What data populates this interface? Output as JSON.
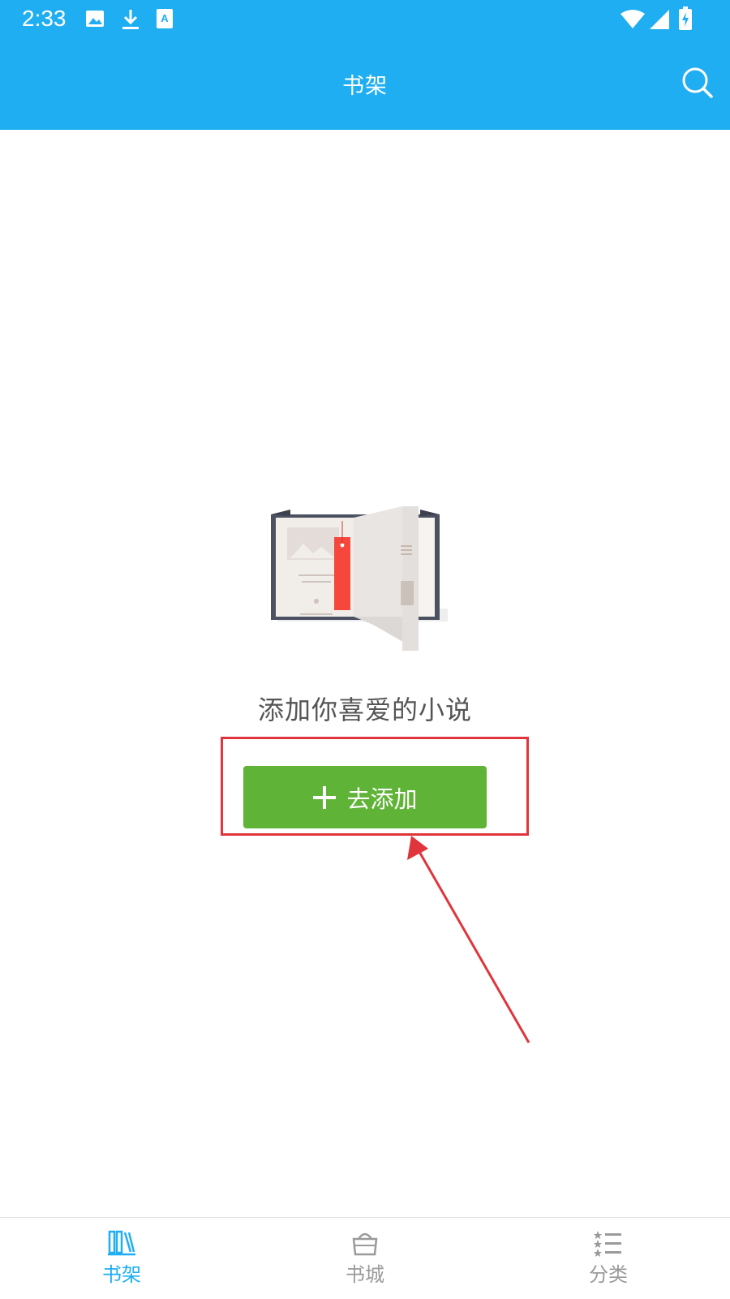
{
  "status_bar": {
    "time": "2:33",
    "left_icons": [
      "image-icon",
      "download-icon",
      "text-a-icon"
    ],
    "right_icons": [
      "wifi-icon",
      "signal-icon",
      "battery-charging-icon"
    ]
  },
  "app_bar": {
    "title": "书架",
    "action_icon": "search-icon",
    "color": "#1faef2"
  },
  "empty_state": {
    "illustration": "open-book-bookmark",
    "message": "添加你喜爱的小说",
    "button_label": "去添加",
    "button_icon": "plus-icon",
    "button_color": "#5fb336"
  },
  "annotation": {
    "box_color": "#e0353c",
    "arrow_color": "#e0353c"
  },
  "bottom_nav": {
    "active_color": "#1faef2",
    "inactive_color": "#9a9a9a",
    "items": [
      {
        "label": "书架",
        "icon": "bookshelf-icon",
        "active": true
      },
      {
        "label": "书城",
        "icon": "store-basket-icon",
        "active": false
      },
      {
        "label": "分类",
        "icon": "category-list-icon",
        "active": false
      }
    ]
  }
}
